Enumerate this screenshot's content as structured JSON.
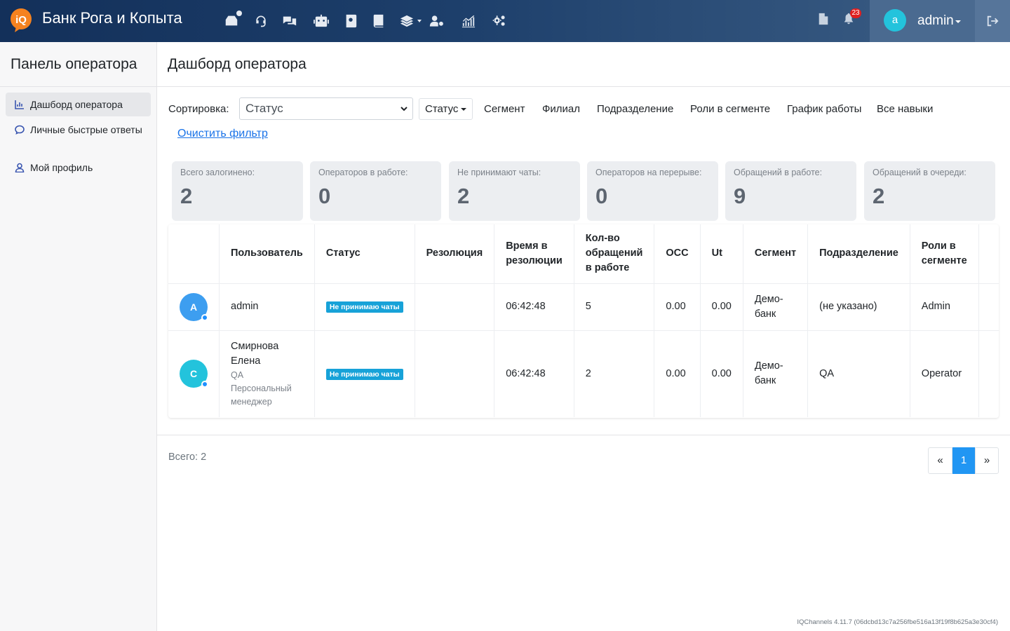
{
  "app": {
    "brand": "Банк Рога и Копыта",
    "logo_text": "iQ",
    "notifications_count": "23",
    "user_initial": "a",
    "user_name": "admin",
    "nav_icons": [
      "inbox-icon",
      "headset-icon",
      "chats-icon",
      "robot-icon",
      "contacts-icon",
      "book-icon",
      "layers-icon",
      "users-gear-icon",
      "analytics-icon",
      "settings-icon"
    ]
  },
  "sidebar": {
    "title": "Панель оператора",
    "items": [
      {
        "label": "Дашборд оператора",
        "icon": "chart-icon",
        "active": true
      },
      {
        "label": "Личные быстрые ответы",
        "icon": "chat-bubble-icon",
        "active": false
      },
      {
        "label": "Мой профиль",
        "icon": "user-icon",
        "active": false
      }
    ]
  },
  "page": {
    "title": "Дашборд оператора"
  },
  "filters": {
    "sort_label": "Сортировка:",
    "sort_value": "Статус",
    "links": [
      "Статус",
      "Сегмент",
      "Филиал",
      "Подразделение",
      "Роли в сегменте",
      "График работы",
      "Все навыки"
    ],
    "clear": "Очистить фильтр"
  },
  "stats": [
    {
      "label": "Всего залогинено:",
      "value": "2"
    },
    {
      "label": "Операторов в работе:",
      "value": "0"
    },
    {
      "label": "Не принимают чаты:",
      "value": "2"
    },
    {
      "label": "Операторов на перерыве:",
      "value": "0"
    },
    {
      "label": "Обращений в работе:",
      "value": "9"
    },
    {
      "label": "Обращений в очереди:",
      "value": "2"
    }
  ],
  "table": {
    "headers": [
      "",
      "Пользователь",
      "Статус",
      "Резолюция",
      "Время в резолюции",
      "Кол-во обращений в работе",
      "OCC",
      "Ut",
      "Сегмент",
      "Подразделение",
      "Роли в сегменте"
    ],
    "rows": [
      {
        "initial": "A",
        "avatar_color": "#3d9ef0",
        "name": "admin",
        "dept_line": "",
        "title_line": "",
        "status": "Не принимаю чаты",
        "resolution": "",
        "time": "06:42:48",
        "count": "5",
        "occ": "0.00",
        "ut": "0.00",
        "segment": "Демо-банк",
        "division": "(не указано)",
        "role": "Admin"
      },
      {
        "initial": "С",
        "avatar_color": "#23c3dc",
        "name": "Смирнова Елена",
        "dept_line": "QA",
        "title_line": "Персональный менеджер",
        "status": "Не принимаю чаты",
        "resolution": "",
        "time": "06:42:48",
        "count": "2",
        "occ": "0.00",
        "ut": "0.00",
        "segment": "Демо-банк",
        "division": "QA",
        "role": "Operator"
      }
    ]
  },
  "footer": {
    "total": "Всего: 2",
    "pager": {
      "prev": "«",
      "current": "1",
      "next": "»"
    },
    "version": "IQChannels 4.11.7 (06dcbd13c7a256fbe516a13f19f8b625a3e30cf4)"
  },
  "colors": {
    "accent": "#2196f3",
    "status_badge": "#17a2d8",
    "notification_badge": "#e02020",
    "logo": "#f5821f"
  }
}
